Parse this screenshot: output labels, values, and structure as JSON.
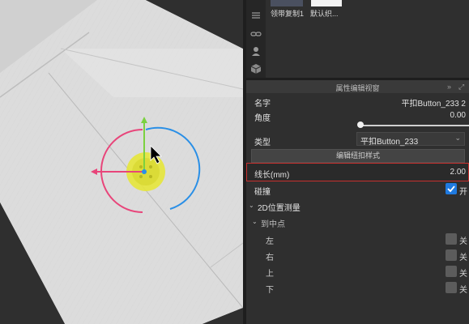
{
  "library": {
    "items": [
      {
        "label": "领带复制1",
        "color": "#4a5060"
      },
      {
        "label": "默认织...",
        "color": "#f2f2f2"
      }
    ]
  },
  "sidebar": {
    "icons": [
      "fabric-icon",
      "link-icon",
      "avatar-icon",
      "cube-icon"
    ]
  },
  "properties": {
    "title": "属性编辑视窗",
    "collapse_icon": "»",
    "expand_icon": "⤢",
    "name_label": "名字",
    "name_value": "平扣Button_233 2",
    "angle_label": "角度",
    "angle_value": "0.00",
    "type_label": "类型",
    "type_value": "平扣Button_233",
    "edit_button": "编辑纽扣样式",
    "thread_length_label": "线长(mm)",
    "thread_length_value": "2.00",
    "collision_label": "碰撞",
    "collision_state": "开",
    "measure_section": "2D位置测量",
    "to_center_section": "到中点",
    "directions": [
      {
        "label": "左",
        "state": "关"
      },
      {
        "label": "右",
        "state": "关"
      },
      {
        "label": "上",
        "state": "关"
      },
      {
        "label": "下",
        "state": "关"
      }
    ]
  },
  "colors": {
    "highlight_border": "#c8302e",
    "checkbox_on": "#1f7ae0",
    "gizmo_x": "#e8457a",
    "gizmo_y": "#7bd13f",
    "gizmo_z": "#2a8fe6",
    "button_body": "#e6e63a"
  }
}
